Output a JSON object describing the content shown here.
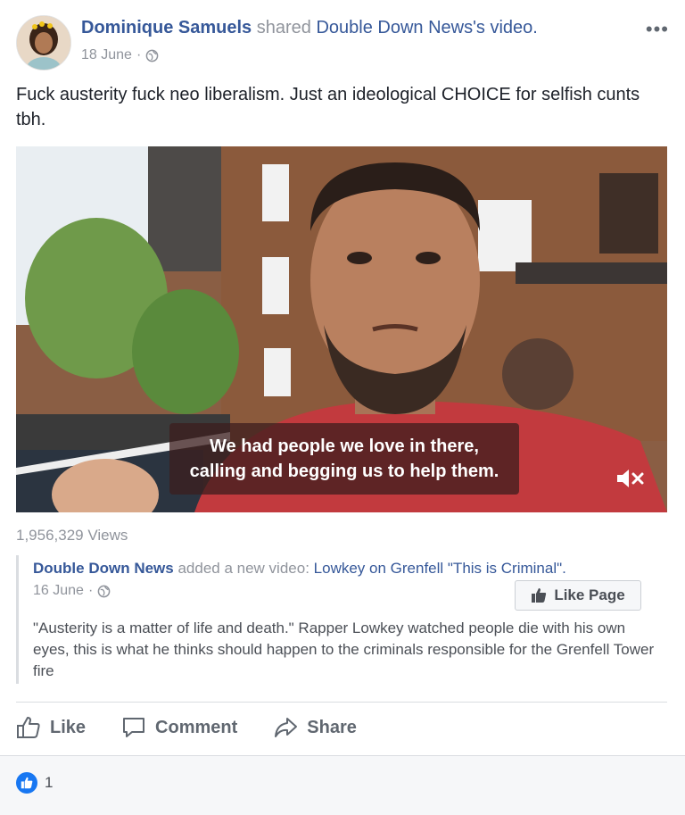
{
  "post": {
    "author": "Dominique Samuels",
    "shared_text": "shared",
    "source": "Double Down News",
    "source_suffix": "'s",
    "object": "video.",
    "date": "18 June",
    "date_sep": "·",
    "text": "Fuck austerity fuck neo liberalism. Just an ideological CHOICE for selfish cunts tbh.",
    "more_icon": "more-options-icon"
  },
  "video": {
    "caption_line1": "We had people we love in there,",
    "caption_line2": "calling and begging us to help them.",
    "mute_icon": "mute-icon",
    "views": "1,956,329 Views"
  },
  "shared_post": {
    "page_name": "Double Down News",
    "action_text": "added a new video:",
    "video_title": "Lowkey on Grenfell \"This is Criminal\".",
    "date": "16 June",
    "date_sep": "·",
    "like_page_label": "Like Page",
    "description": "\"Austerity is a matter of life and death.\" Rapper Lowkey watched people die with his own eyes, this is what he thinks should happen to the criminals responsible for the Grenfell Tower fire"
  },
  "actions": {
    "like": "Like",
    "comment": "Comment",
    "share": "Share"
  },
  "reactions": {
    "count": "1"
  },
  "colors": {
    "link": "#365899",
    "muted": "#90949c",
    "reaction_blue": "#1877f2"
  }
}
